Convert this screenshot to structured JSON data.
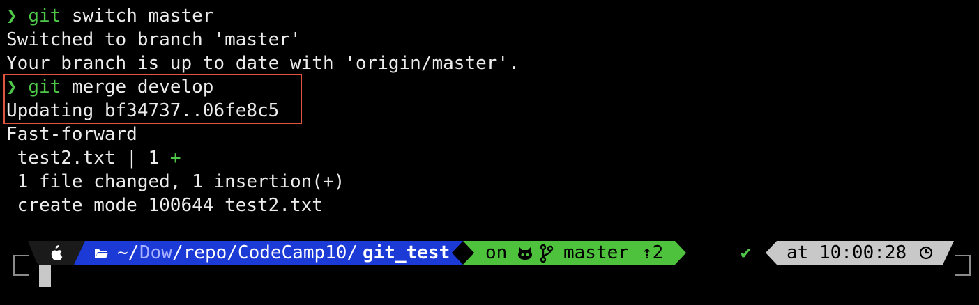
{
  "terminal": {
    "lines": [
      {
        "prompt": "❯",
        "cmd": "git",
        "args": " switch master"
      },
      {
        "text": "Switched to branch 'master'"
      },
      {
        "text": "Your branch is up to date with 'origin/master'."
      },
      {
        "prompt": "❯",
        "cmd": "git",
        "args": " merge develop"
      },
      {
        "text": "Updating bf34737..06fe8c5"
      },
      {
        "text": "Fast-forward"
      },
      {
        "file": " test2.txt | 1 ",
        "plus": "+"
      },
      {
        "text": " 1 file changed, 1 insertion(+)"
      },
      {
        "text": " create mode 100644 test2.txt"
      }
    ]
  },
  "prompt_bar": {
    "os_icon": "apple-icon",
    "folder_icon": "folder-icon",
    "path_home": "~/",
    "path_dim": "Dow",
    "path_mid": "/repo/CodeCamp10/",
    "path_last": "git_test",
    "vcs_on": "on",
    "github_icon": "github-icon",
    "branch_icon": "git-branch-icon",
    "branch": "master",
    "ahead": "⇡2",
    "status_check": "✔",
    "time_label": "at 10:00:28",
    "clock_icon": "clock-icon"
  },
  "colors": {
    "prompt_green": "#4fc84a",
    "highlight_border": "#e0553d",
    "os_segment": "#1a1a1a",
    "dir_segment": "#1b3ad6",
    "vcs_segment": "#4ec23c",
    "time_segment": "#c8c8c8"
  }
}
